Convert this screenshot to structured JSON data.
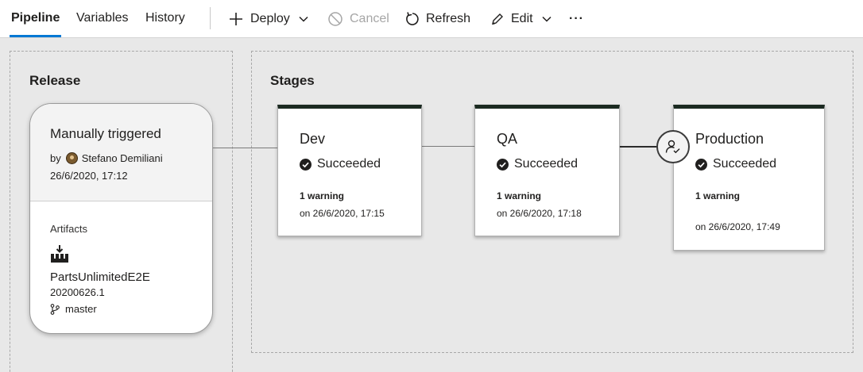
{
  "tabs": [
    {
      "label": "Pipeline",
      "active": true
    },
    {
      "label": "Variables",
      "active": false
    },
    {
      "label": "History",
      "active": false
    }
  ],
  "toolbar": {
    "deploy": {
      "label": "Deploy",
      "icon": "plus-icon"
    },
    "cancel": {
      "label": "Cancel",
      "icon": "cancel-icon",
      "disabled": true
    },
    "refresh": {
      "label": "Refresh",
      "icon": "refresh-icon"
    },
    "edit": {
      "label": "Edit",
      "icon": "pencil-icon"
    },
    "more": {
      "label": "···"
    }
  },
  "release": {
    "title": "Release",
    "trigger": "Manually triggered",
    "by_prefix": "by",
    "user": "Stefano Demiliani",
    "date": "26/6/2020, 17:12",
    "artifacts_label": "Artifacts",
    "artifact": {
      "name": "PartsUnlimitedE2E",
      "version": "20200626.1",
      "branch": "master"
    }
  },
  "stages_title": "Stages",
  "stages": [
    {
      "name": "Dev",
      "status": "Succeeded",
      "warning": "1 warning",
      "date": "on 26/6/2020, 17:15"
    },
    {
      "name": "QA",
      "status": "Succeeded",
      "warning": "1 warning",
      "date": "on 26/6/2020, 17:18"
    },
    {
      "name": "Production",
      "status": "Succeeded",
      "warning": "1 warning",
      "date": "on 26/6/2020, 17:49"
    }
  ],
  "colors": {
    "accent": "#0078d4",
    "stage_header": "#1b2a21",
    "background": "#e8e8e8"
  }
}
